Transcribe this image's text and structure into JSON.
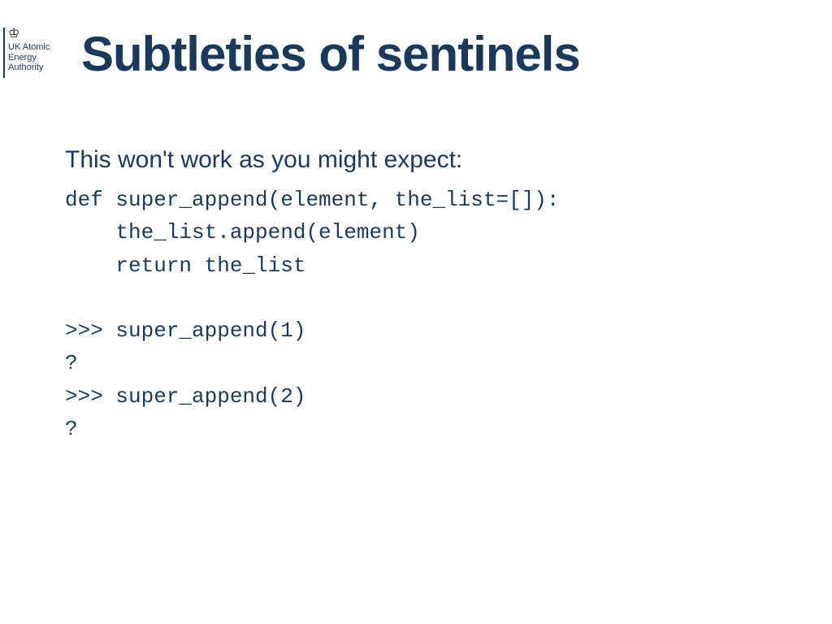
{
  "logo": {
    "org_line1": "UK Atomic",
    "org_line2": "Energy",
    "org_line3": "Authority"
  },
  "title": "Subtleties of sentinels",
  "intro": "This won't work as you might expect:",
  "code": "def super_append(element, the_list=[]):\n    the_list.append(element)\n    return the_list\n\n>>> super_append(1)\n?\n>>> super_append(2)\n?"
}
